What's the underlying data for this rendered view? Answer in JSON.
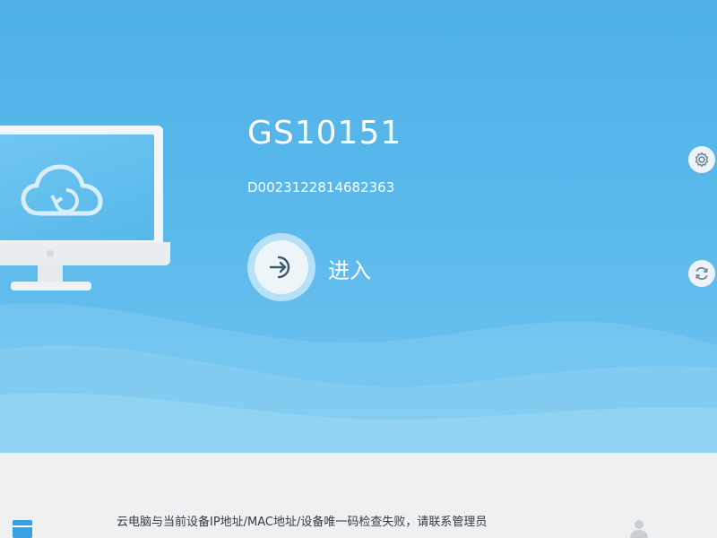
{
  "device": {
    "name": "GS10151",
    "id": "D0023122814682363"
  },
  "actions": {
    "enter_label": "进入",
    "side_button_1_label": "",
    "side_button_2_label": ""
  },
  "status_bar": {
    "message": "云电脑与当前设备IP地址/MAC地址/设备唯一码检查失败，请联系管理员"
  },
  "icons": {
    "enter": "login-arrow-icon",
    "settings": "gear-icon",
    "refresh": "refresh-icon",
    "cloud": "cloud-sync-icon",
    "user": "user-icon",
    "menu": "menu-icon"
  },
  "colors": {
    "background": "#5cbaec",
    "text_primary": "#ffffff",
    "bottom_bar": "#eef0f2",
    "accent": "#3aa0e4"
  }
}
